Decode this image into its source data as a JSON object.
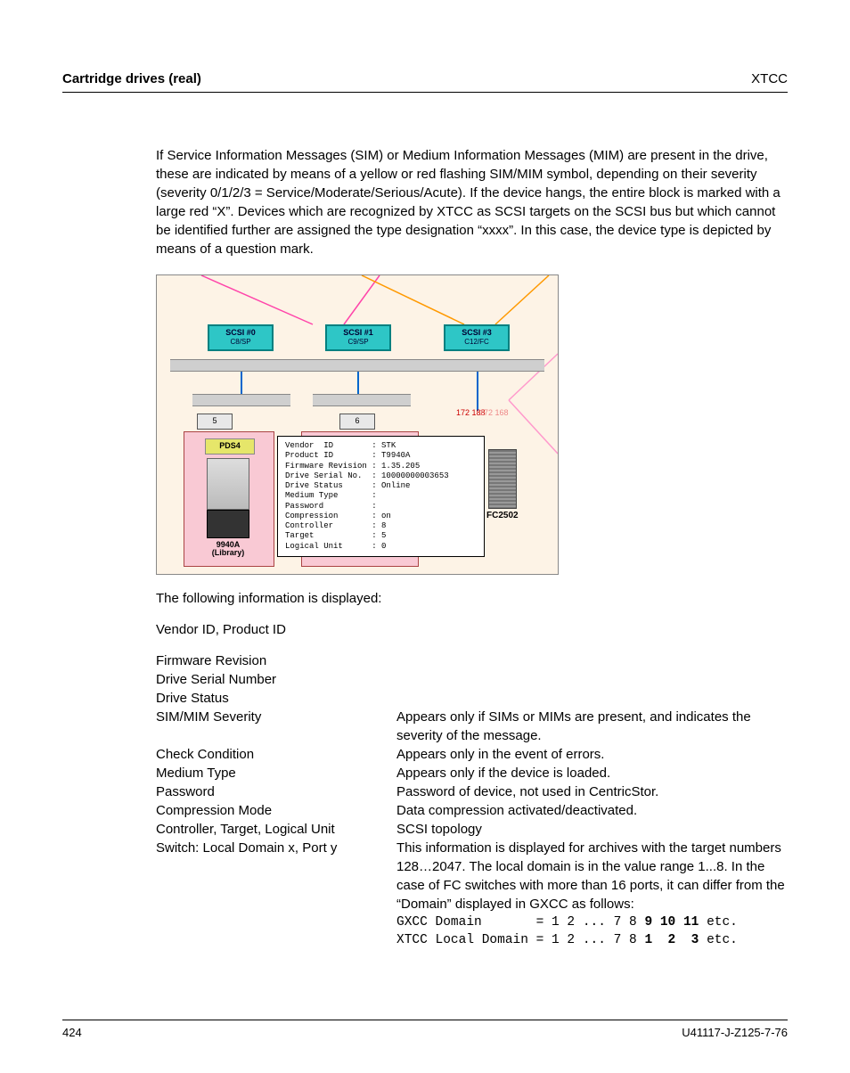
{
  "header": {
    "left": "Cartridge drives (real)",
    "right": "XTCC"
  },
  "para1": "If Service Information Messages (SIM) or Medium Information Messages (MIM) are present in the drive, these are indicated by means of a yellow or red flashing SIM/MIM symbol, depending on their severity (severity 0/1/2/3 = Service/Moderate/Serious/Acute). If the device hangs, the entire block is marked with a large red “X”. Devices which are recognized by XTCC as SCSI targets on the SCSI bus but which cannot be identified further are assigned the type designation “xxxx”. In this case, the device type is depicted by means of a question mark.",
  "figure": {
    "scsi": [
      {
        "title": "SCSI #0",
        "sub": "C8/SP"
      },
      {
        "title": "SCSI #1",
        "sub": "C9/SP"
      },
      {
        "title": "SCSI #3",
        "sub": "C12/FC"
      }
    ],
    "node5": "5",
    "node6": "6",
    "ip1": "172\n188",
    "ip2": "172\n168",
    "pds": "PDS4",
    "drive_label": "9940A\n(Library)",
    "fc_label": "FC2502",
    "tooltip_lines": [
      "Vendor  ID        : STK",
      "Product ID        : T9940A",
      "Firmware Revision : 1.35.205",
      "Drive Serial No.  : 10000000003653",
      "Drive Status      : Online",
      "Medium Type       :",
      "Password          :",
      "Compression       : on",
      "Controller        : 8",
      "Target            : 5",
      "Logical Unit      : 0"
    ]
  },
  "para2": "The following information is displayed:",
  "para3": "Vendor ID, Product ID",
  "info": [
    {
      "label": "Firmware Revision",
      "desc": ""
    },
    {
      "label": "Drive Serial Number",
      "desc": ""
    },
    {
      "label": "Drive Status",
      "desc": ""
    },
    {
      "label": "SIM/MIM Severity",
      "desc": "Appears only if SIMs or MIMs are present, and indicates the severity of the message."
    },
    {
      "label": "Check Condition",
      "desc": "Appears only in the event of errors."
    },
    {
      "label": "Medium Type",
      "desc": "Appears only if the device is loaded."
    },
    {
      "label": "Password",
      "desc": "Password of device, not used in CentricStor."
    },
    {
      "label": "Compression Mode",
      "desc": "Data compression activated/deactivated."
    },
    {
      "label": "Controller, Target, Logical Unit",
      "desc": "SCSI topology"
    },
    {
      "label": "Switch: Local Domain x, Port y",
      "desc": "This information is displayed for archives with the target numbers 128…2047. The local domain is in the value range 1...8. In the case of FC switches with more than 16 ports, it can differ from the “Domain” displayed in GXCC as follows:"
    }
  ],
  "mono_lines": {
    "line1_prefix": "GXCC Domain       = 1 2 ... 7 8 ",
    "line1_bold": "9 10 11",
    "line1_suffix": " etc.",
    "line2_prefix": "XTCC Local Domain = 1 2 ... 7 8 ",
    "line2_bold": "1  2  3",
    "line2_suffix": " etc."
  },
  "footer": {
    "page": "424",
    "docid": "U41117-J-Z125-7-76"
  }
}
